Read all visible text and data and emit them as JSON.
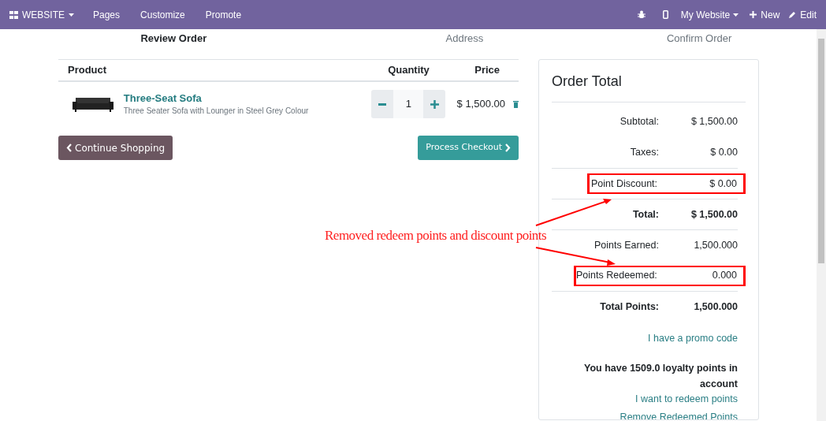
{
  "navbar": {
    "app_menu": "WEBSITE",
    "items": [
      "Pages",
      "Customize",
      "Promote"
    ],
    "website_menu": "My Website",
    "new": "New",
    "edit": "Edit"
  },
  "steps": [
    {
      "label": "Review Order",
      "selected": true
    },
    {
      "label": "Address",
      "selected": false
    },
    {
      "label": "Confirm Order",
      "selected": false
    }
  ],
  "cart": {
    "columns": [
      "Product",
      "Quantity",
      "Price"
    ],
    "rows": [
      {
        "name": "Three-Seat Sofa",
        "description": "Three Seater Sofa with Lounger in Steel Grey Colour",
        "quantity": "1",
        "price": "$ 1,500.00"
      }
    ]
  },
  "buttons": {
    "continue": "Continue Shopping",
    "checkout": "Process Checkout"
  },
  "order_total": {
    "title": "Order Total",
    "rows": [
      {
        "label": "Subtotal:",
        "value": "$ 1,500.00",
        "bold": false,
        "highlighted": false,
        "divider_above": false
      },
      {
        "label": "Taxes:",
        "value": "$ 0.00",
        "bold": false,
        "highlighted": false,
        "divider_above": false
      },
      {
        "label": "Point Discount:",
        "value": "$ 0.00",
        "bold": false,
        "highlighted": true,
        "divider_above": true
      },
      {
        "label": "Total:",
        "value": "$ 1,500.00",
        "bold": true,
        "highlighted": false,
        "divider_above": true
      },
      {
        "label": "Points Earned:",
        "value": "1,500.000",
        "bold": false,
        "highlighted": false,
        "divider_above": true
      },
      {
        "label": "Points Redeemed:",
        "value": "0.000",
        "bold": false,
        "highlighted": true,
        "divider_above": false
      },
      {
        "label": "Total Points:",
        "value": "1,500.000",
        "bold": true,
        "highlighted": false,
        "divider_above": true
      }
    ],
    "promo_link": "I have a promo code",
    "loyalty_text": "You have 1509.0 loyalty points in account",
    "redeem_link": "I want to redeem points",
    "remove_link": "Remove Redeemed Points"
  },
  "annotation": {
    "text": "Removed redeem points and discount points"
  }
}
